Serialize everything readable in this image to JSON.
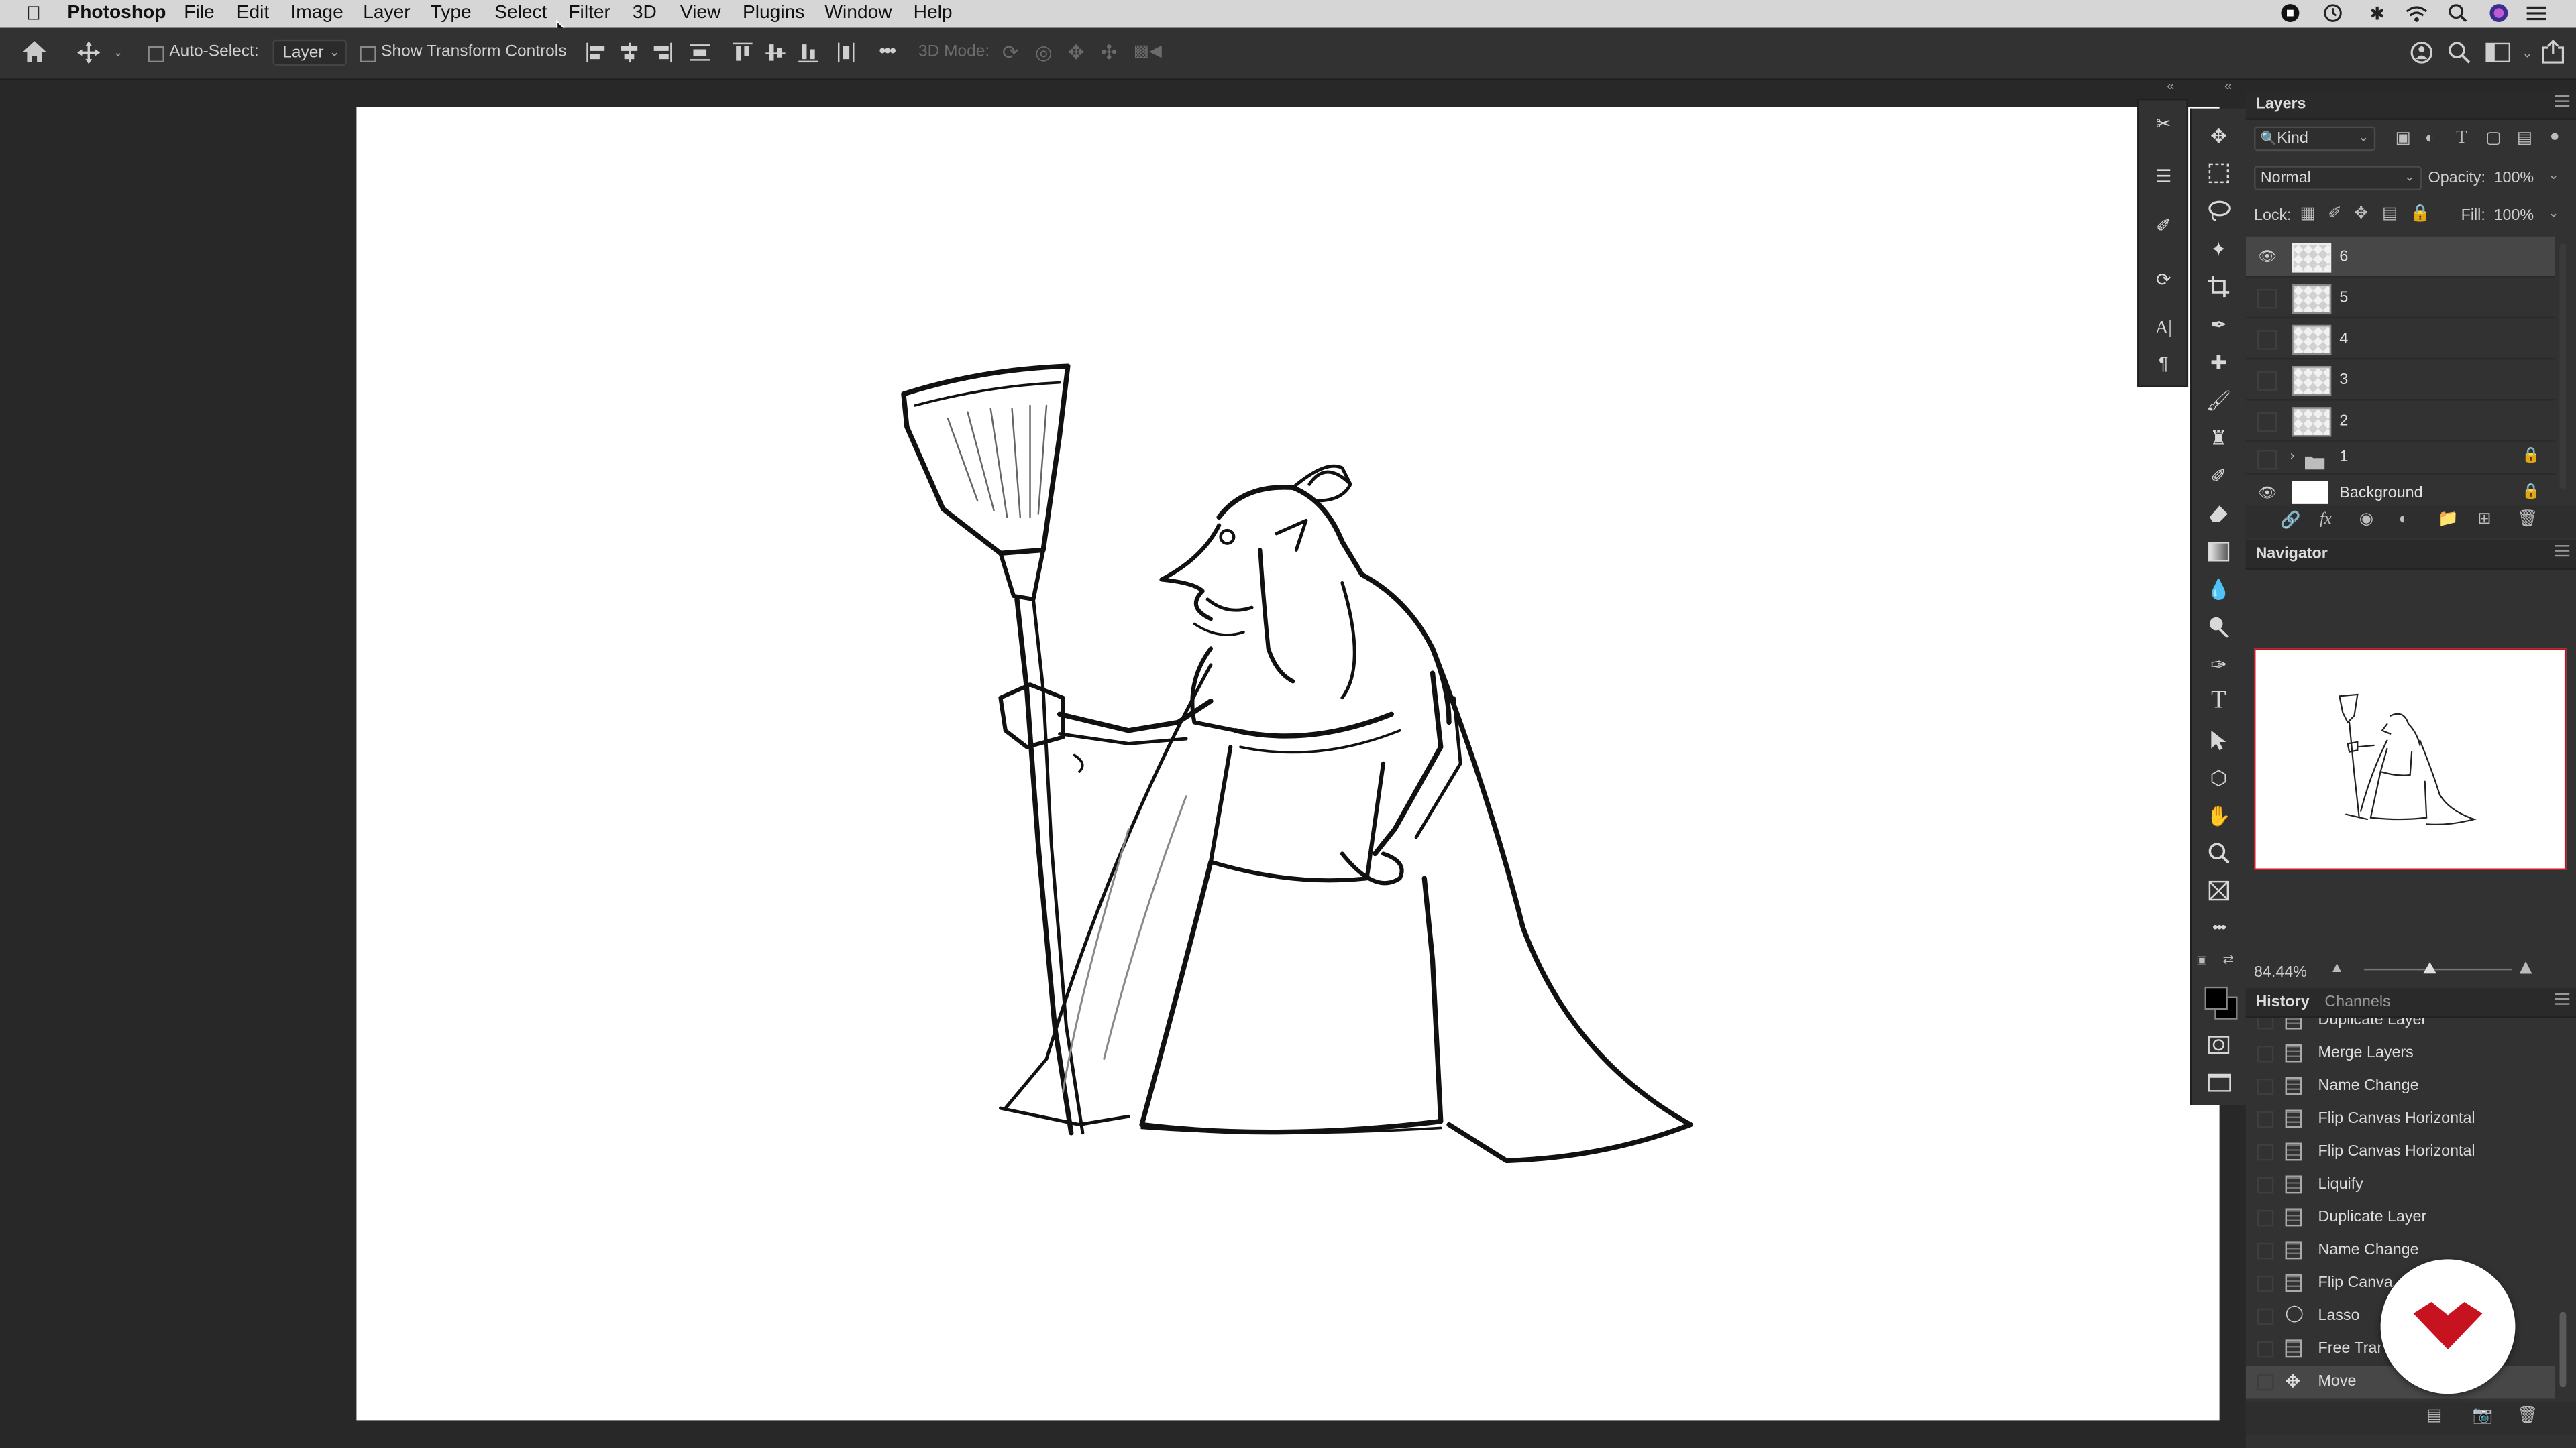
{
  "menubar": {
    "app_name": "Photoshop",
    "items": [
      "File",
      "Edit",
      "Image",
      "Layer",
      "Type",
      "Select",
      "Filter",
      "3D",
      "View",
      "Plugins",
      "Window",
      "Help"
    ]
  },
  "options_bar": {
    "auto_select_label": "Auto-Select:",
    "auto_select_target": "Layer",
    "show_transform_label": "Show Transform Controls",
    "more_label": "•••",
    "mode_3d_label": "3D Mode:"
  },
  "layers_panel": {
    "title": "Layers",
    "filter_kind": "Kind",
    "blend_mode": "Normal",
    "opacity_label": "Opacity:",
    "opacity_value": "100%",
    "lock_label": "Lock:",
    "fill_label": "Fill:",
    "fill_value": "100%",
    "layers": [
      {
        "name": "6",
        "visible": true,
        "selected": true
      },
      {
        "name": "5",
        "visible": false,
        "selected": false
      },
      {
        "name": "4",
        "visible": false,
        "selected": false
      },
      {
        "name": "3",
        "visible": false,
        "selected": false
      },
      {
        "name": "2",
        "visible": false,
        "selected": false
      },
      {
        "name": "1",
        "visible": false,
        "selected": false,
        "group": true,
        "locked": true
      },
      {
        "name": "Background",
        "visible": true,
        "selected": false,
        "locked": true
      }
    ]
  },
  "navigator_panel": {
    "title": "Navigator",
    "zoom_value": "84.44%"
  },
  "history_panel": {
    "tab_history": "History",
    "tab_channels": "Channels",
    "items": [
      "Duplicate Layer",
      "Merge Layers",
      "Name Change",
      "Flip Canvas Horizontal",
      "Flip Canvas Horizontal",
      "Liquify",
      "Duplicate Layer",
      "Name Change",
      "Flip Canvas Horizontal",
      "Lasso",
      "Free Transform",
      "Move"
    ],
    "selected_index": 11
  },
  "colors": {
    "accent_red": "#c7131f",
    "panel_bg": "#323232",
    "canvas_bg": "#ffffff"
  }
}
